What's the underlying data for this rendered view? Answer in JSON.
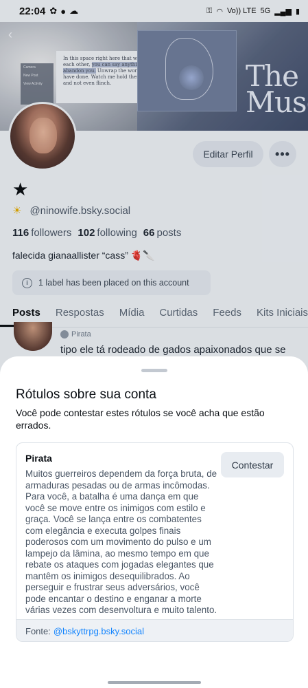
{
  "status_bar": {
    "time": "22:04",
    "left_icons": [
      "pinwheel-icon",
      "facebook-icon",
      "cloud-icon"
    ],
    "right_icons": [
      "key-icon",
      "wifi-icon",
      "volte-icon",
      "signal-icon",
      "battery-icon"
    ],
    "volte_text": "Vo)) LTE",
    "network_text": "5G"
  },
  "banner": {
    "menu_items": [
      "Camera",
      "New Post",
      "View Activity"
    ],
    "quote_plain_1": "In this space right here that we have made for each other, ",
    "quote_highlight": "you can say anything and I will not abandon you.",
    "quote_plain_2": " Unwrap the worst things you have done. Watch me hold them up to the light and not even flinch.",
    "art_text": "The Muse"
  },
  "profile": {
    "edit_label": "Editar Perfil",
    "more_label": "•••",
    "display_name": "★",
    "handle_emoji": "☀",
    "handle": "@ninowife.bsky.social",
    "followers_count": "116",
    "followers_label": "followers",
    "following_count": "102",
    "following_label": "following",
    "posts_count": "66",
    "posts_label": "posts",
    "bio": "falecida gianaallister “cass” 🫀🔪",
    "label_notice": "1 label has been placed on this account"
  },
  "tabs": [
    "Posts",
    "Respostas",
    "Mídia",
    "Curtidas",
    "Feeds",
    "Kits Iniciais"
  ],
  "active_tab": "Posts",
  "post_preview": {
    "tag": "Pirata",
    "text": "tipo ele tá rodeado de gados apaixonados que se"
  },
  "sheet": {
    "title": "Rótulos sobre sua conta",
    "subtitle": "Você pode contestar estes rótulos se você acha que estão errados.",
    "label_name": "Pirata",
    "contest_label": "Contestar",
    "description": "Muitos guerreiros dependem da força bruta, de armaduras pesadas ou de armas incômodas. Para você, a batalha é uma dança em que você se move entre os inimigos com estilo e graça. Você se lança entre os combatentes com elegância e executa golpes finais poderosos com um movimento do pulso e um lampejo da lâmina, ao mesmo tempo em que rebate os ataques com jogadas elegantes que mantêm os inimigos desequilibrados. Ao perseguir e frustrar seus adversários, você pode encantar o destino e enganar a morte várias vezes com desenvoltura e muito talento.",
    "source_prefix": "Fonte:",
    "source_link": "@bskyttrpg.bsky.social"
  },
  "colors": {
    "link": "#1083fe",
    "sheet_bg": "#ffffff",
    "dim_bg": "#e8ecf1"
  }
}
